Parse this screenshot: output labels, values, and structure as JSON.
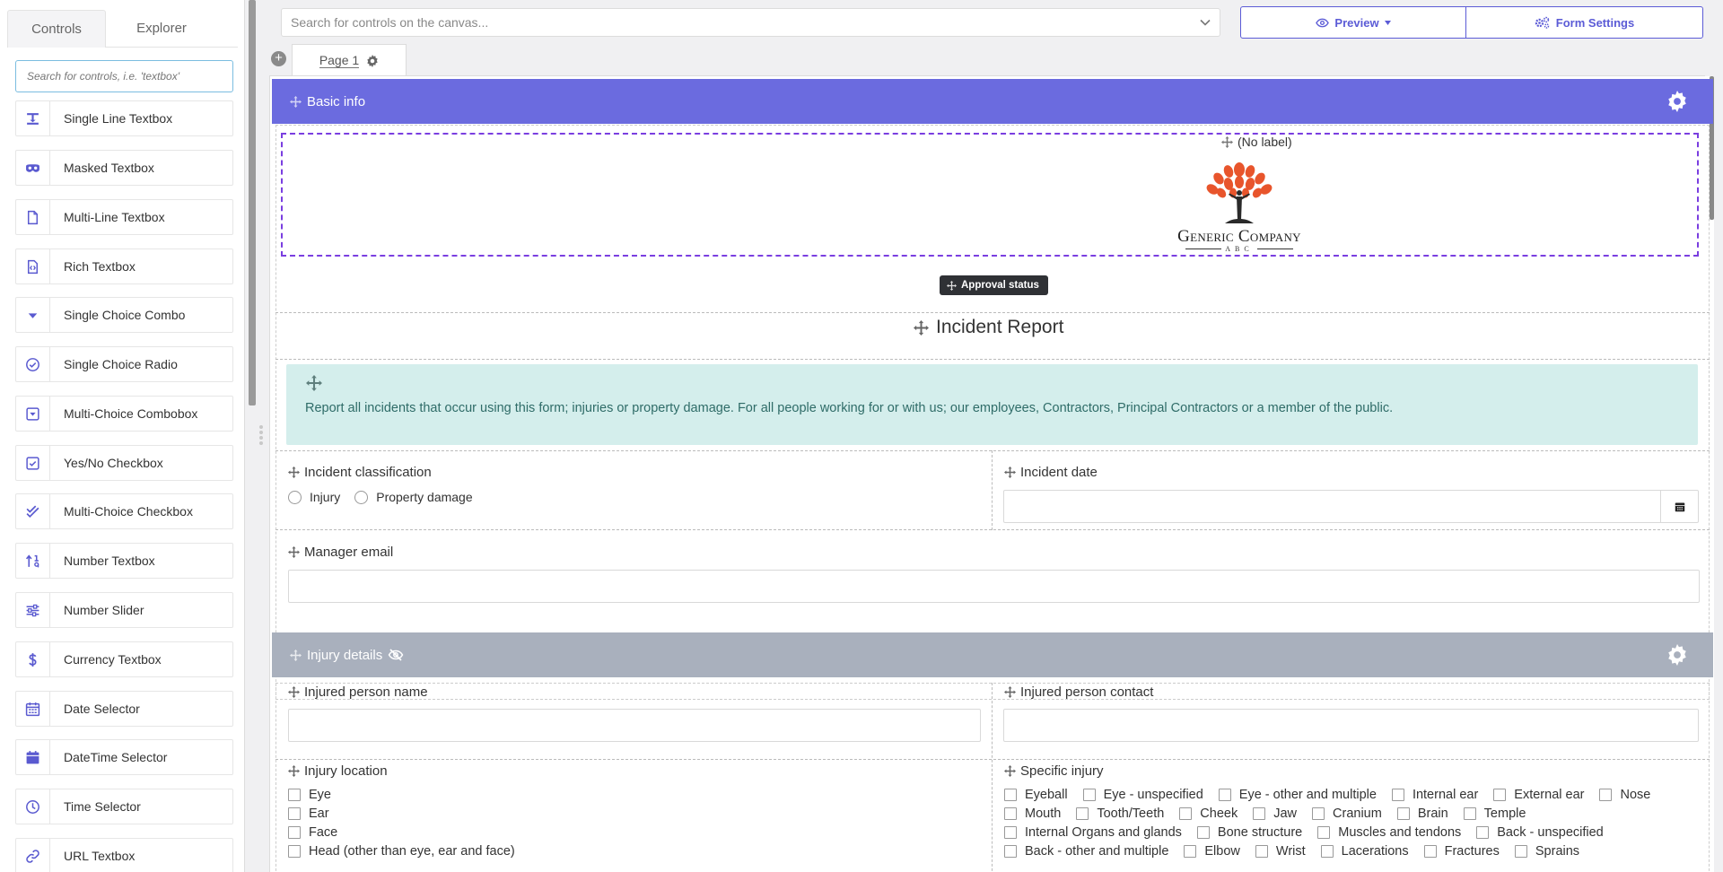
{
  "left_panel": {
    "tabs": [
      "Controls",
      "Explorer"
    ],
    "search_placeholder": "Search for controls, i.e. 'textbox'",
    "controls": [
      {
        "label": "Single Line Textbox",
        "icon": "single-line-textbox-icon"
      },
      {
        "label": "Masked Textbox",
        "icon": "mask-icon"
      },
      {
        "label": "Multi-Line Textbox",
        "icon": "file-icon"
      },
      {
        "label": "Rich Textbox",
        "icon": "code-file-icon"
      },
      {
        "label": "Single Choice Combo",
        "icon": "caret-down-icon"
      },
      {
        "label": "Single Choice Radio",
        "icon": "check-circle-icon"
      },
      {
        "label": "Multi-Choice Combobox",
        "icon": "dropdown-box-icon"
      },
      {
        "label": "Yes/No Checkbox",
        "icon": "checkbox-icon"
      },
      {
        "label": "Multi-Choice Checkbox",
        "icon": "double-check-icon"
      },
      {
        "label": "Number Textbox",
        "icon": "sort-number-icon"
      },
      {
        "label": "Number Slider",
        "icon": "sliders-icon"
      },
      {
        "label": "Currency Textbox",
        "icon": "dollar-icon"
      },
      {
        "label": "Date Selector",
        "icon": "calendar-icon"
      },
      {
        "label": "DateTime Selector",
        "icon": "calendar-filled-icon"
      },
      {
        "label": "Time Selector",
        "icon": "clock-icon"
      },
      {
        "label": "URL Textbox",
        "icon": "link-icon"
      }
    ]
  },
  "toolbar": {
    "canvas_search_placeholder": "Search for controls on the canvas...",
    "preview_label": "Preview",
    "form_settings_label": "Form Settings"
  },
  "page_tab": {
    "label": "Page 1"
  },
  "sections": {
    "basic_info": {
      "title": "Basic info",
      "color": "#6b6bdf",
      "image_label": "(No label)",
      "logo_text_main": "Generic Company",
      "logo_text_sub": "ABC",
      "approval_badge": "Approval status",
      "heading": "Incident Report",
      "info_text": "Report all incidents that occur using this form; injuries or property damage. For all people working for or with us; our employees, Contractors, Principal Contractors or a member of the public.",
      "incident_classification": {
        "label": "Incident classification",
        "options": [
          "Injury",
          "Property damage"
        ]
      },
      "incident_date": {
        "label": "Incident date"
      },
      "manager_email": {
        "label": "Manager email"
      }
    },
    "injury_details": {
      "title": "Injury details",
      "color": "#a9b0bd",
      "injured_person_name": {
        "label": "Injured person name"
      },
      "injured_person_contact": {
        "label": "Injured person contact"
      },
      "injury_location": {
        "label": "Injury location",
        "options": [
          "Eye",
          "Ear",
          "Face",
          "Head (other than eye, ear and face)"
        ]
      },
      "specific_injury": {
        "label": "Specific injury",
        "rows": [
          [
            "Eyeball",
            "Eye - unspecified",
            "Eye - other and multiple",
            "Internal ear",
            "External ear",
            "Nose"
          ],
          [
            "Mouth",
            "Tooth/Teeth",
            "Cheek",
            "Jaw",
            "Cranium",
            "Brain",
            "Temple"
          ],
          [
            "Internal Organs and glands",
            "Bone structure",
            "Muscles and tendons",
            "Back - unspecified"
          ],
          [
            "Back - other and multiple",
            "Elbow",
            "Wrist",
            "Lacerations",
            "Fractures",
            "Sprains"
          ]
        ]
      }
    }
  }
}
